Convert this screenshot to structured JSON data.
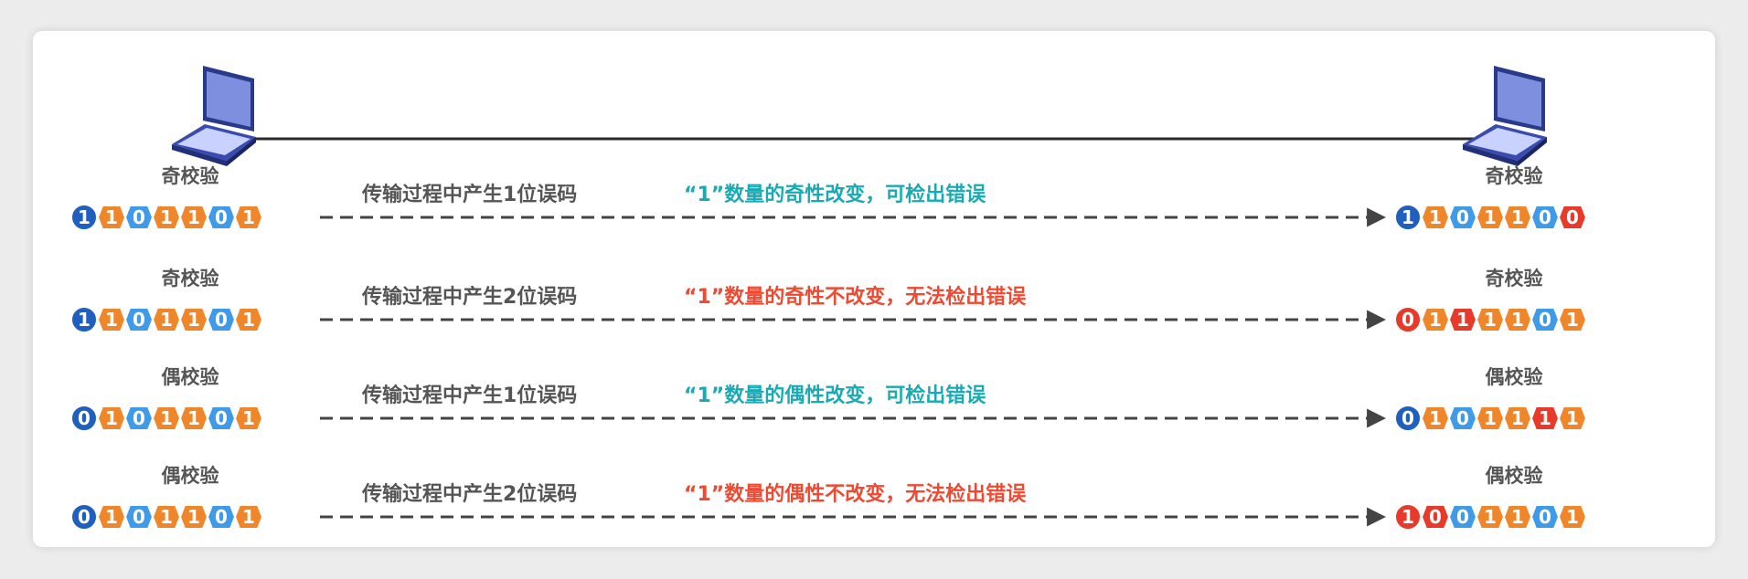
{
  "colors": {
    "first_bit": "#1f5fbf",
    "bit_one": "#f0862a",
    "bit_zero": "#3f9be8",
    "error_bit": "#e83a2a",
    "detected_text": "#1aaab3",
    "undetected_text": "#ee4a32",
    "label_text": "#555555"
  },
  "icons": [
    "laptop-icon",
    "laptop-icon"
  ],
  "rows": [
    {
      "check_label": "奇校验",
      "transmission_note": "传输过程中产生1位误码",
      "result_note": "“1”数量的奇性改变，可检出错误",
      "detected": true,
      "sent_bits": [
        "1",
        "1",
        "0",
        "1",
        "1",
        "0",
        "1"
      ],
      "received_bits": [
        "1",
        "1",
        "0",
        "1",
        "1",
        "0",
        "0"
      ],
      "error_positions": [
        6
      ]
    },
    {
      "check_label": "奇校验",
      "transmission_note": "传输过程中产生2位误码",
      "result_note": "“1”数量的奇性不改变，无法检出错误",
      "detected": false,
      "sent_bits": [
        "1",
        "1",
        "0",
        "1",
        "1",
        "0",
        "1"
      ],
      "received_bits": [
        "0",
        "1",
        "1",
        "1",
        "1",
        "0",
        "1"
      ],
      "error_positions": [
        0,
        2
      ]
    },
    {
      "check_label": "偶校验",
      "transmission_note": "传输过程中产生1位误码",
      "result_note": "“1”数量的偶性改变，可检出错误",
      "detected": true,
      "sent_bits": [
        "0",
        "1",
        "0",
        "1",
        "1",
        "0",
        "1"
      ],
      "received_bits": [
        "0",
        "1",
        "0",
        "1",
        "1",
        "1",
        "1"
      ],
      "error_positions": [
        5
      ]
    },
    {
      "check_label": "偶校验",
      "transmission_note": "传输过程中产生2位误码",
      "result_note": "“1”数量的偶性不改变，无法检出错误",
      "detected": false,
      "sent_bits": [
        "0",
        "1",
        "0",
        "1",
        "1",
        "0",
        "1"
      ],
      "received_bits": [
        "1",
        "0",
        "0",
        "1",
        "1",
        "0",
        "1"
      ],
      "error_positions": [
        0,
        1
      ]
    }
  ]
}
